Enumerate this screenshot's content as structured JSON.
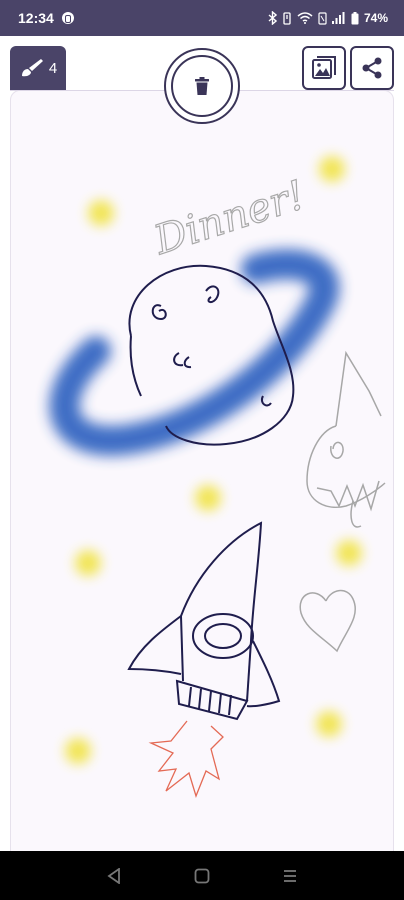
{
  "status_bar": {
    "time": "12:34",
    "battery": "74%"
  },
  "toolbar": {
    "brush_count": "4"
  },
  "canvas": {
    "handwritten_text": "Dinner!"
  },
  "colors": {
    "brand": "#4a4468",
    "canvas_bg": "#fbf8fd",
    "ink_navy": "#1f1d4d",
    "ink_blue": "#2f62c0",
    "ink_gray": "#a7a7a7",
    "ink_red": "#e46a55",
    "star_yellow": "#f0e23a"
  },
  "icons": {
    "brush": "paintbrush-icon",
    "trash": "trash-icon",
    "gallery": "image-gallery-icon",
    "share": "share-icon",
    "back": "nav-back-icon",
    "home": "nav-home-icon",
    "recents": "nav-recents-icon"
  }
}
